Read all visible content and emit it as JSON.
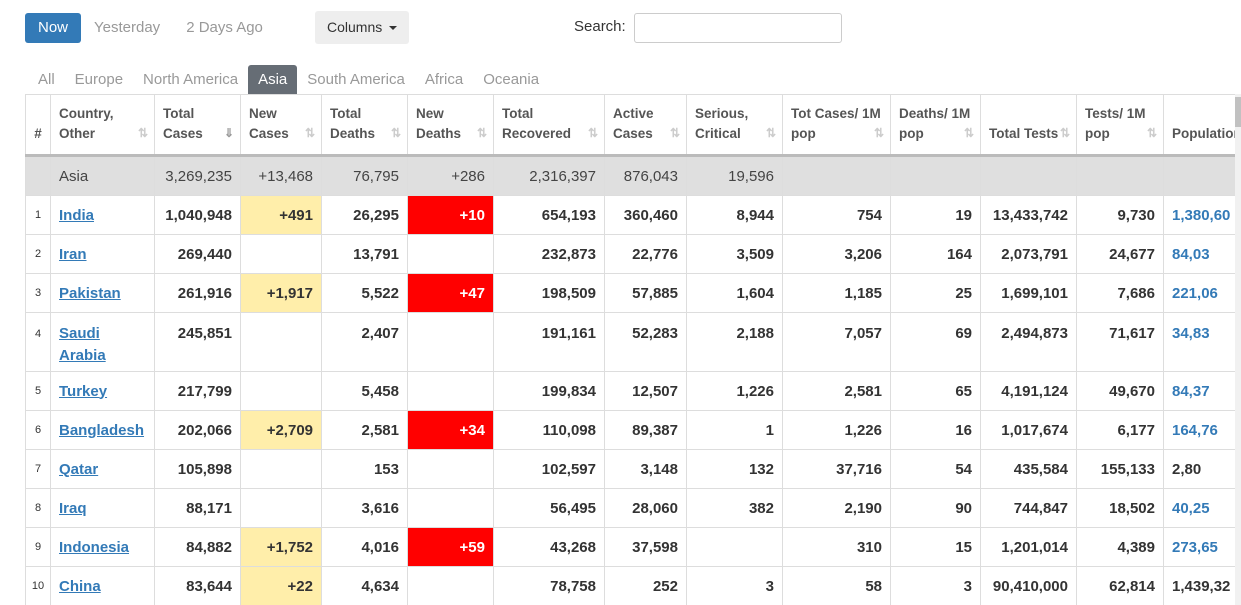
{
  "day_buttons": [
    "Now",
    "Yesterday",
    "2 Days Ago"
  ],
  "columns_button": "Columns",
  "search": {
    "label": "Search:",
    "value": ""
  },
  "region_tabs": [
    "All",
    "Europe",
    "North America",
    "Asia",
    "South America",
    "Africa",
    "Oceania"
  ],
  "active_tab": "Asia",
  "colors": {
    "accent": "#337ab7",
    "new_cases_bg": "#ffeeaa",
    "new_deaths_bg": "#ff0000",
    "total_row_bg": "#dfdfdf"
  },
  "headers": [
    "#",
    "Country, Other",
    "Total Cases",
    "New Cases",
    "Total Deaths",
    "New Deaths",
    "Total Recovered",
    "Active Cases",
    "Serious, Critical",
    "Tot Cases/ 1M pop",
    "Deaths/ 1M pop",
    "Total Tests",
    "Tests/ 1M pop",
    "Population"
  ],
  "total_row": {
    "name": "Asia",
    "total_cases": "3,269,235",
    "new_cases": "+13,468",
    "total_deaths": "76,795",
    "new_deaths": "+286",
    "recovered": "2,316,397",
    "active": "876,043",
    "serious": "19,596"
  },
  "rows": [
    {
      "n": "1",
      "country": "India",
      "tc": "1,040,948",
      "nc": "+491",
      "td": "26,295",
      "nd": "+10",
      "tr": "654,193",
      "ac": "360,460",
      "sc": "8,944",
      "tcm": "754",
      "dm": "19",
      "tt": "13,433,742",
      "tm": "9,730",
      "pop": "1,380,60"
    },
    {
      "n": "2",
      "country": "Iran",
      "tc": "269,440",
      "nc": "",
      "td": "13,791",
      "nd": "",
      "tr": "232,873",
      "ac": "22,776",
      "sc": "3,509",
      "tcm": "3,206",
      "dm": "164",
      "tt": "2,073,791",
      "tm": "24,677",
      "pop": "84,03"
    },
    {
      "n": "3",
      "country": "Pakistan",
      "tc": "261,916",
      "nc": "+1,917",
      "td": "5,522",
      "nd": "+47",
      "tr": "198,509",
      "ac": "57,885",
      "sc": "1,604",
      "tcm": "1,185",
      "dm": "25",
      "tt": "1,699,101",
      "tm": "7,686",
      "pop": "221,06"
    },
    {
      "n": "4",
      "country": "Saudi Arabia",
      "tc": "245,851",
      "nc": "",
      "td": "2,407",
      "nd": "",
      "tr": "191,161",
      "ac": "52,283",
      "sc": "2,188",
      "tcm": "7,057",
      "dm": "69",
      "tt": "2,494,873",
      "tm": "71,617",
      "pop": "34,83"
    },
    {
      "n": "5",
      "country": "Turkey",
      "tc": "217,799",
      "nc": "",
      "td": "5,458",
      "nd": "",
      "tr": "199,834",
      "ac": "12,507",
      "sc": "1,226",
      "tcm": "2,581",
      "dm": "65",
      "tt": "4,191,124",
      "tm": "49,670",
      "pop": "84,37"
    },
    {
      "n": "6",
      "country": "Bangladesh",
      "tc": "202,066",
      "nc": "+2,709",
      "td": "2,581",
      "nd": "+34",
      "tr": "110,098",
      "ac": "89,387",
      "sc": "1",
      "tcm": "1,226",
      "dm": "16",
      "tt": "1,017,674",
      "tm": "6,177",
      "pop": "164,76"
    },
    {
      "n": "7",
      "country": "Qatar",
      "tc": "105,898",
      "nc": "",
      "td": "153",
      "nd": "",
      "tr": "102,597",
      "ac": "3,148",
      "sc": "132",
      "tcm": "37,716",
      "dm": "54",
      "tt": "435,584",
      "tm": "155,133",
      "pop": "2,80"
    },
    {
      "n": "8",
      "country": "Iraq",
      "tc": "88,171",
      "nc": "",
      "td": "3,616",
      "nd": "",
      "tr": "56,495",
      "ac": "28,060",
      "sc": "382",
      "tcm": "2,190",
      "dm": "90",
      "tt": "744,847",
      "tm": "18,502",
      "pop": "40,25"
    },
    {
      "n": "9",
      "country": "Indonesia",
      "tc": "84,882",
      "nc": "+1,752",
      "td": "4,016",
      "nd": "+59",
      "tr": "43,268",
      "ac": "37,598",
      "sc": "",
      "tcm": "310",
      "dm": "15",
      "tt": "1,201,014",
      "tm": "4,389",
      "pop": "273,65"
    },
    {
      "n": "10",
      "country": "China",
      "tc": "83,644",
      "nc": "+22",
      "td": "4,634",
      "nd": "",
      "tr": "78,758",
      "ac": "252",
      "sc": "3",
      "tcm": "58",
      "dm": "3",
      "tt": "90,410,000",
      "tm": "62,814",
      "pop": "1,439,32"
    }
  ]
}
